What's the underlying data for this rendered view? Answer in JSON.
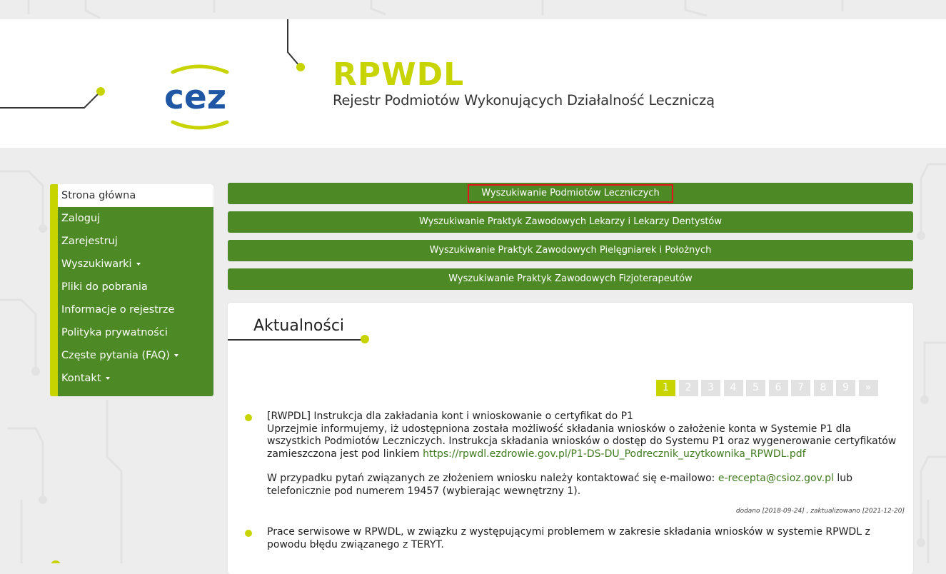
{
  "colors": {
    "brand_green": "#4d8a26",
    "accent_lime": "#c8d400",
    "highlight_red": "#e3151a"
  },
  "header": {
    "logo_text": "cez",
    "title": "RPWDL",
    "subtitle": "Rejestr Podmiotów Wykonujących Działalność Leczniczą"
  },
  "sidebar": {
    "items": [
      {
        "label": "Strona główna",
        "active": true,
        "dropdown": false
      },
      {
        "label": "Zaloguj",
        "active": false,
        "dropdown": false
      },
      {
        "label": "Zarejestruj",
        "active": false,
        "dropdown": false
      },
      {
        "label": "Wyszukiwarki",
        "active": false,
        "dropdown": true
      },
      {
        "label": "Pliki do pobrania",
        "active": false,
        "dropdown": false
      },
      {
        "label": "Informacje o rejestrze",
        "active": false,
        "dropdown": false
      },
      {
        "label": "Polityka prywatności",
        "active": false,
        "dropdown": false
      },
      {
        "label": "Częste pytania (FAQ)",
        "active": false,
        "dropdown": true
      },
      {
        "label": "Kontakt",
        "active": false,
        "dropdown": true
      }
    ]
  },
  "search_buttons": [
    {
      "label": "Wyszukiwanie Podmiotów Leczniczych",
      "highlighted": true
    },
    {
      "label": "Wyszukiwanie Praktyk Zawodowych Lekarzy i Lekarzy Dentystów",
      "highlighted": false
    },
    {
      "label": "Wyszukiwanie Praktyk Zawodowych Pielęgniarek i Położnych",
      "highlighted": false
    },
    {
      "label": "Wyszukiwanie Praktyk Zawodowych Fizjoterapeutów",
      "highlighted": false
    }
  ],
  "news": {
    "heading": "Aktualności",
    "pagination": {
      "pages": [
        "1",
        "2",
        "3",
        "4",
        "5",
        "6",
        "7",
        "8",
        "9"
      ],
      "current": "1",
      "next": "»"
    },
    "items": [
      {
        "title": "[RWPDL] Instrukcja dla zakładania kont i wnioskowanie o certyfikat do P1",
        "text_before_link": "Uprzejmie informujemy, iż udostępniona została możliwość składania wniosków o założenie konta w Systemie P1 dla wszystkich Podmiotów Leczniczych. Instrukcja składania wniosków o dostęp do Systemu P1 oraz wygenerowanie certyfikatów zamieszczona jest pod linkiem",
        "link": "https://rpwdl.ezdrowie.gov.pl/P1-DS-DU_Podrecznik_uzytkownika_RPWDL.pdf",
        "contact_before": "W przypadku pytań związanych ze złożeniem wniosku należy kontaktować się e-mailowo:",
        "email": "e-recepta@csioz.gov.pl",
        "contact_after": "lub telefonicznie pod numerem 19457 (wybierając wewnętrzny 1).",
        "meta": "dodano [2018-09-24] , zaktualizowano [2021-12-20]"
      },
      {
        "title": "Prace serwisowe w RPWDL, w związku z występującymi problemem w zakresie składania wniosków w systemie RPWDL z powodu błędu związanego z TERYT."
      }
    ]
  }
}
